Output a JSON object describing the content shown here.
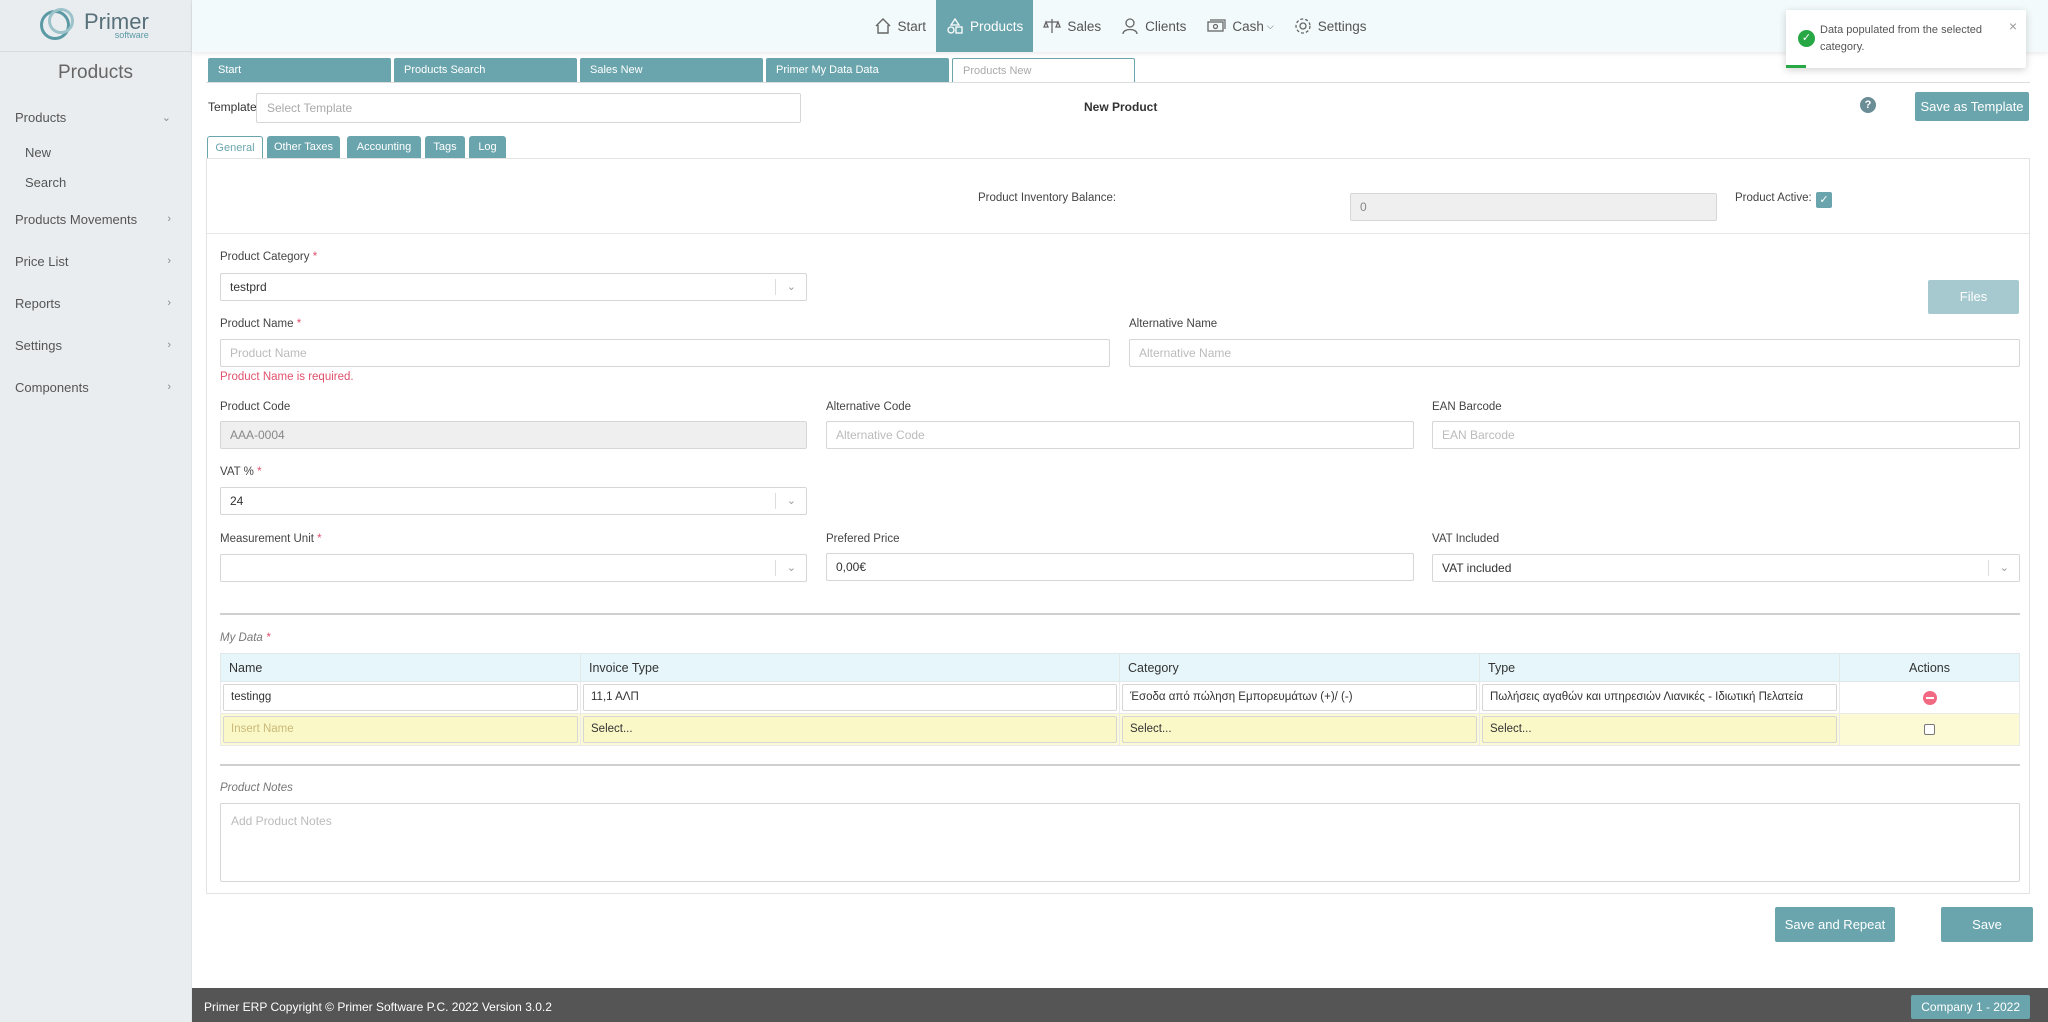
{
  "app": {
    "logo_main": "Primer",
    "logo_sub": "software"
  },
  "sidebar": {
    "title": "Products",
    "items": [
      {
        "label": "Products",
        "expanded": true,
        "children": [
          "New",
          "Search"
        ]
      },
      {
        "label": "Products Movements"
      },
      {
        "label": "Price List"
      },
      {
        "label": "Reports"
      },
      {
        "label": "Settings"
      },
      {
        "label": "Components"
      }
    ]
  },
  "topnav": {
    "items": [
      {
        "label": "Start",
        "icon": "home-icon"
      },
      {
        "label": "Products",
        "icon": "shapes-icon",
        "active": true
      },
      {
        "label": "Sales",
        "icon": "scale-icon"
      },
      {
        "label": "Clients",
        "icon": "user-icon"
      },
      {
        "label": "Cash",
        "icon": "cash-icon",
        "dropdown": true
      },
      {
        "label": "Settings",
        "icon": "gear-icon"
      }
    ]
  },
  "toast": {
    "message": "Data populated from the selected category.",
    "type": "success",
    "color": "#28a745"
  },
  "page_tabs": [
    "Start",
    "Products Search",
    "Sales New",
    "Primer My Data Data",
    "Products New"
  ],
  "template": {
    "label": "Template",
    "placeholder": "Select Template"
  },
  "page_title": "New Product",
  "buttons": {
    "save_template": "Save as Template",
    "files": "Files",
    "save_repeat": "Save and Repeat",
    "save": "Save"
  },
  "form_tabs": [
    "General",
    "Other Taxes",
    "Accounting",
    "Tags",
    "Log"
  ],
  "form": {
    "inventory_balance_label": "Product Inventory Balance:",
    "inventory_balance_value": "0",
    "product_active_label": "Product Active:",
    "product_active": true,
    "category_label": "Product Category",
    "category_value": "testprd",
    "name_label": "Product Name",
    "name_placeholder": "Product Name",
    "name_error": "Product Name is required.",
    "alt_name_label": "Alternative Name",
    "alt_name_placeholder": "Alternative Name",
    "code_label": "Product Code",
    "code_value": "AAA-0004",
    "alt_code_label": "Alternative Code",
    "alt_code_placeholder": "Alternative Code",
    "ean_label": "EAN Barcode",
    "ean_placeholder": "EAN Barcode",
    "vat_label": "VAT %",
    "vat_value": "24",
    "unit_label": "Measurement Unit",
    "unit_value": "",
    "price_label": "Prefered Price",
    "price_value": "0,00€",
    "vat_included_label": "VAT Included",
    "vat_included_value": "VAT included",
    "required_mark": "*"
  },
  "mydata": {
    "section_label": "My Data",
    "columns": [
      "Name",
      "Invoice Type",
      "Category",
      "Type",
      "Actions"
    ],
    "rows": [
      {
        "name": "testingg",
        "invoice_type": "11,1 ΑΛΠ",
        "category": "Έσοδα από πώληση Εμπορευμάτων (+)/ (-)",
        "type": "Πωλήσεις αγαθών και υπηρεσιών Λιανικές - Ιδιωτική Πελατεία"
      }
    ],
    "new_row": {
      "name_placeholder": "Insert Name",
      "invoice_type": "Select...",
      "category": "Select...",
      "type": "Select..."
    }
  },
  "notes": {
    "label": "Product Notes",
    "placeholder": "Add Product Notes"
  },
  "footer": {
    "copyright": "Primer ERP Copyright © Primer Software P.C. 2022 Version 3.0.2",
    "company": "Company 1 - 2022"
  },
  "colors": {
    "accent": "#6aa5ad",
    "error": "#e0516e",
    "highlight_row": "#fcfad5"
  }
}
